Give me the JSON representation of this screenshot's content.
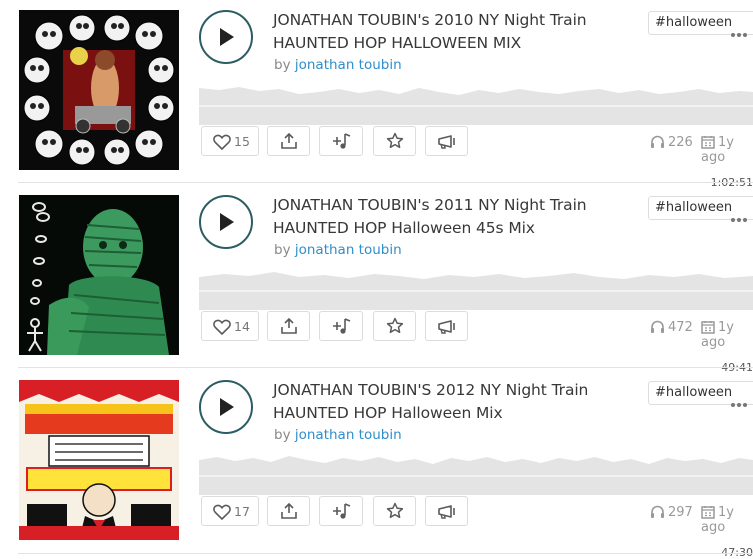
{
  "tracks": [
    {
      "title": "JONATHAN TOUBIN's 2010 NY Night Train HAUNTED HOP HALLOWEEN MIX",
      "by_label": "by",
      "author": "jonathan toubin",
      "tag": "#halloween",
      "duration": "1:02:51",
      "likes": "15",
      "plays": "226",
      "age": "1y ago",
      "art_icon": "skull-collage-art",
      "art_color": "#000000"
    },
    {
      "title": "JONATHAN TOUBIN's 2011 NY Night Train HAUNTED HOP Halloween 45s Mix",
      "by_label": "by",
      "author": "jonathan toubin",
      "tag": "#halloween",
      "duration": "49:41",
      "likes": "14",
      "plays": "472",
      "age": "1y ago",
      "art_icon": "green-mummy-art",
      "art_color": "#2e8a50"
    },
    {
      "title": "JONATHAN TOUBIN'S 2012 NY Night Train HAUNTED HOP Halloween Mix",
      "by_label": "by",
      "author": "jonathan toubin",
      "tag": "#halloween",
      "duration": "47:30",
      "likes": "17",
      "plays": "297",
      "age": "1y ago",
      "art_icon": "haunted-hop-poster-art",
      "art_color": "#d81f26"
    }
  ],
  "icons": {
    "play": "play-icon",
    "like": "heart-icon",
    "share": "share-icon",
    "add": "add-to-playlist-icon",
    "favorite": "star-icon",
    "repost": "megaphone-icon",
    "plays": "headphones-icon",
    "date": "calendar-icon",
    "more": "more-dots-icon"
  },
  "colors": {
    "accent_link": "#2e8fcc",
    "play_ring": "#2b5d63",
    "waveform": "#e4e4e4"
  }
}
